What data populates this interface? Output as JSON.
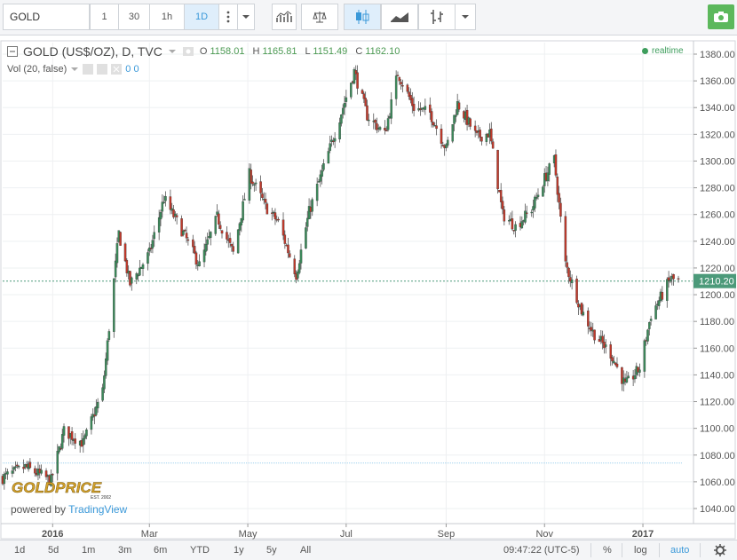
{
  "toolbar": {
    "symbol": "GOLD",
    "intervals": [
      "1",
      "30",
      "1h",
      "1D"
    ],
    "active_interval": "1D"
  },
  "legend": {
    "symbol_line": "GOLD (US$/OZ), D, TVC",
    "open_label": "O",
    "open_value": "1158.01",
    "high_label": "H",
    "high_value": "1165.81",
    "low_label": "L",
    "low_value": "1151.49",
    "close_label": "C",
    "close_value": "1162.10",
    "volume_label": "Vol (20, false)",
    "volume_values": "0 0",
    "realtime": "realtime"
  },
  "watermark": {
    "logo_text": "GOLDPRICE",
    "logo_sub": "EST. 2002",
    "powered_prefix": "powered by",
    "powered_brand": "TradingView"
  },
  "bottom": {
    "ranges": [
      "1d",
      "5d",
      "1m",
      "3m",
      "6m",
      "YTD",
      "1y",
      "5y",
      "All"
    ],
    "time": "09:47:22 (UTC-5)",
    "percent": "%",
    "log": "log",
    "auto": "auto"
  },
  "colors": {
    "up": "#3b8a5a",
    "down": "#c0392b",
    "accent": "#3b99d9",
    "last_price": "#4c9a7a"
  },
  "chart_data": {
    "type": "candlestick",
    "title": "GOLD (US$/OZ), D, TVC",
    "y_ticks": [
      1040,
      1060,
      1080,
      1100,
      1120,
      1140,
      1160,
      1180,
      1200,
      1220,
      1240,
      1260,
      1280,
      1300,
      1320,
      1340,
      1360,
      1380
    ],
    "ylim": [
      1033,
      1386
    ],
    "x_labels": [
      "2016",
      "Mar",
      "May",
      "Jul",
      "Sep",
      "Nov",
      "2017"
    ],
    "last_price": "1210.20",
    "last_price_value": 1210.2,
    "reference_level": 1074,
    "close_series": [
      [
        "2015-12-01",
        1063
      ],
      [
        "2015-12-15",
        1071
      ],
      [
        "2015-12-31",
        1061
      ],
      [
        "2016-01-08",
        1098
      ],
      [
        "2016-01-20",
        1089
      ],
      [
        "2016-02-01",
        1128
      ],
      [
        "2016-02-11",
        1246
      ],
      [
        "2016-02-18",
        1208
      ],
      [
        "2016-03-01",
        1231
      ],
      [
        "2016-03-10",
        1272
      ],
      [
        "2016-03-22",
        1246
      ],
      [
        "2016-04-01",
        1222
      ],
      [
        "2016-04-12",
        1258
      ],
      [
        "2016-04-22",
        1231
      ],
      [
        "2016-05-02",
        1290
      ],
      [
        "2016-05-12",
        1266
      ],
      [
        "2016-05-20",
        1254
      ],
      [
        "2016-05-31",
        1215
      ],
      [
        "2016-06-08",
        1262
      ],
      [
        "2016-06-17",
        1295
      ],
      [
        "2016-06-24",
        1321
      ],
      [
        "2016-07-06",
        1367
      ],
      [
        "2016-07-14",
        1334
      ],
      [
        "2016-07-25",
        1320
      ],
      [
        "2016-08-02",
        1366
      ],
      [
        "2016-08-12",
        1340
      ],
      [
        "2016-08-22",
        1336
      ],
      [
        "2016-09-01",
        1309
      ],
      [
        "2016-09-08",
        1343
      ],
      [
        "2016-09-20",
        1318
      ],
      [
        "2016-09-28",
        1321
      ],
      [
        "2016-10-06",
        1260
      ],
      [
        "2016-10-14",
        1251
      ],
      [
        "2016-10-24",
        1264
      ],
      [
        "2016-11-01",
        1287
      ],
      [
        "2016-11-07",
        1301
      ],
      [
        "2016-11-14",
        1223
      ],
      [
        "2016-11-24",
        1188
      ],
      [
        "2016-12-01",
        1172
      ],
      [
        "2016-12-12",
        1156
      ],
      [
        "2016-12-21",
        1132
      ],
      [
        "2016-12-30",
        1145
      ],
      [
        "2017-01-06",
        1185
      ],
      [
        "2017-01-13",
        1200
      ],
      [
        "2017-01-18",
        1212
      ],
      [
        "2017-01-23",
        1210
      ]
    ]
  }
}
